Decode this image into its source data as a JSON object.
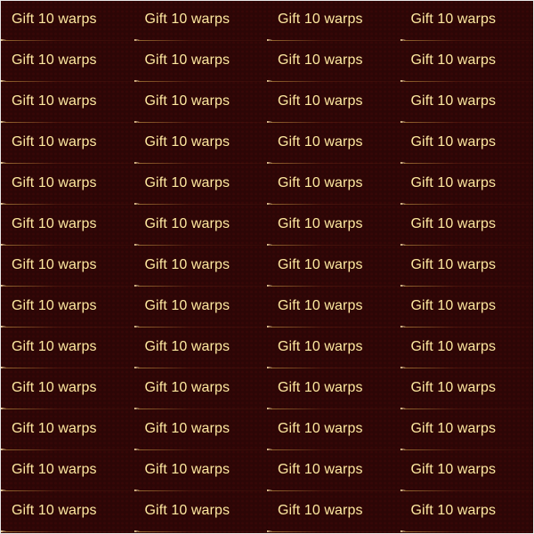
{
  "grid": {
    "columns": 4,
    "rows": 13,
    "cell_label": "Gift 10 warps",
    "colors": {
      "background": "#2c0606",
      "text": "#ffe9a0",
      "divider": "#e6b450",
      "tip": "#f1d29a"
    },
    "divider_icon": "arrow-tip-icon"
  }
}
